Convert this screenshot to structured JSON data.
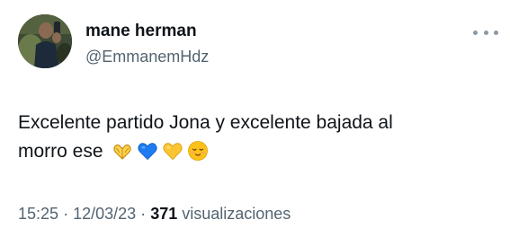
{
  "author": {
    "display_name": "mane herman",
    "handle": "@EmmanemHdz"
  },
  "tweet": {
    "text_line1": "Excelente partido Jona y excelente bajada al",
    "text_line2": "morro ese",
    "emojis": [
      "heart-hands",
      "blue-heart",
      "yellow-heart",
      "relieved-face"
    ]
  },
  "meta": {
    "time": "15:25",
    "separator": "·",
    "date": "12/03/23",
    "views_count": "371",
    "views_label": "visualizaciones"
  },
  "colors": {
    "text": "#0f1419",
    "secondary": "#536471",
    "more_dots": "#8b98a5"
  }
}
